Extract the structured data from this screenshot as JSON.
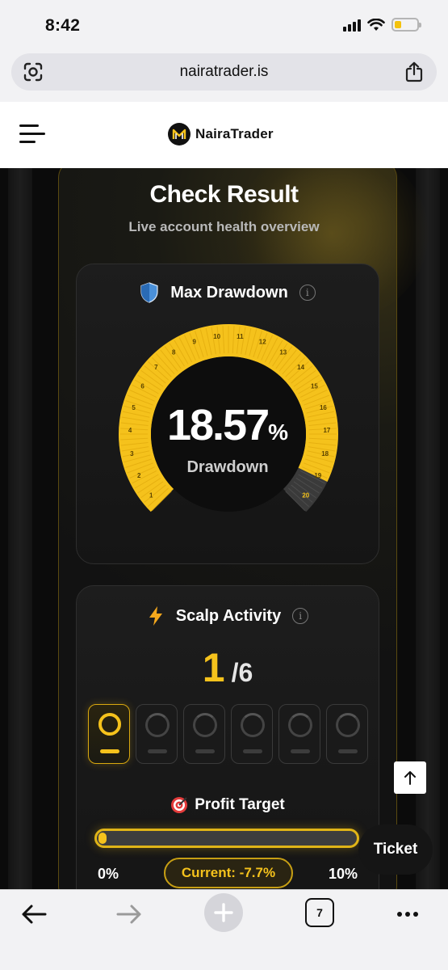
{
  "status_bar": {
    "time": "8:42"
  },
  "browser": {
    "url": "nairatrader.is",
    "tab_count": "7"
  },
  "site": {
    "brand": "NairaTrader"
  },
  "card": {
    "title": "Check Result",
    "subtitle": "Live account health overview"
  },
  "drawdown": {
    "label": "Max Drawdown",
    "value": "18.57",
    "unit": "%",
    "caption": "Drawdown",
    "gauge_max": 20,
    "gauge_value": 18.57,
    "ticks": [
      "1",
      "2",
      "3",
      "4",
      "5",
      "6",
      "7",
      "8",
      "9",
      "10",
      "11",
      "12",
      "13",
      "14",
      "15",
      "16",
      "17",
      "18",
      "19",
      "20"
    ],
    "accent_color": "#f5c21c"
  },
  "scalp": {
    "label": "Scalp Activity",
    "current": "1",
    "total": "/6",
    "used_slots": 1,
    "slot_count": 6
  },
  "profit_target": {
    "label": "Profit Target",
    "min_label": "0%",
    "max_label": "10%",
    "current_label": "Current: -7.7%"
  },
  "floating": {
    "ticket_label": "Ticket"
  },
  "icons": {
    "drawdown": "shield-icon",
    "scalp": "lightning-icon",
    "profit": "target-icon",
    "info": "info-icon",
    "back_to_top": "arrow-up-icon"
  }
}
